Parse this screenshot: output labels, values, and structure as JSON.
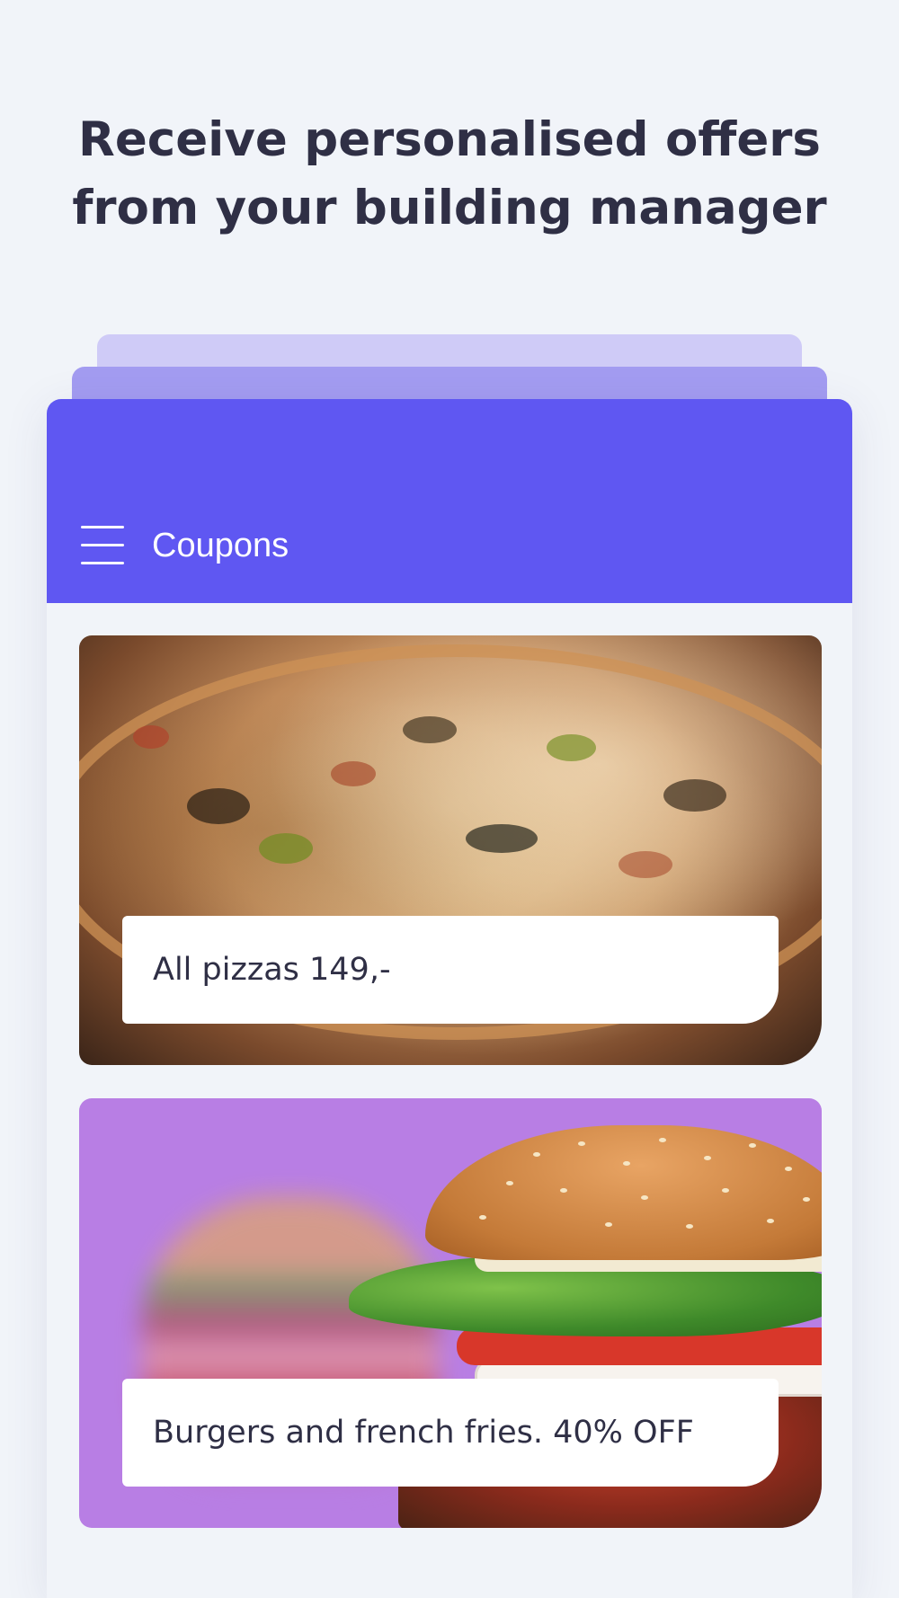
{
  "headline": {
    "line1": "Receive personalised offers",
    "line2": "from your building manager"
  },
  "app": {
    "title": "Coupons",
    "accent_color": "#5f57f2",
    "menu_icon": "hamburger-menu-icon"
  },
  "coupons": [
    {
      "label": "All pizzas 149,-",
      "image": "pizza-photo",
      "background": "#7a4a2c"
    },
    {
      "label": "Burgers and french fries. 40% OFF",
      "image": "burger-photo",
      "background": "#b87ee4"
    }
  ]
}
